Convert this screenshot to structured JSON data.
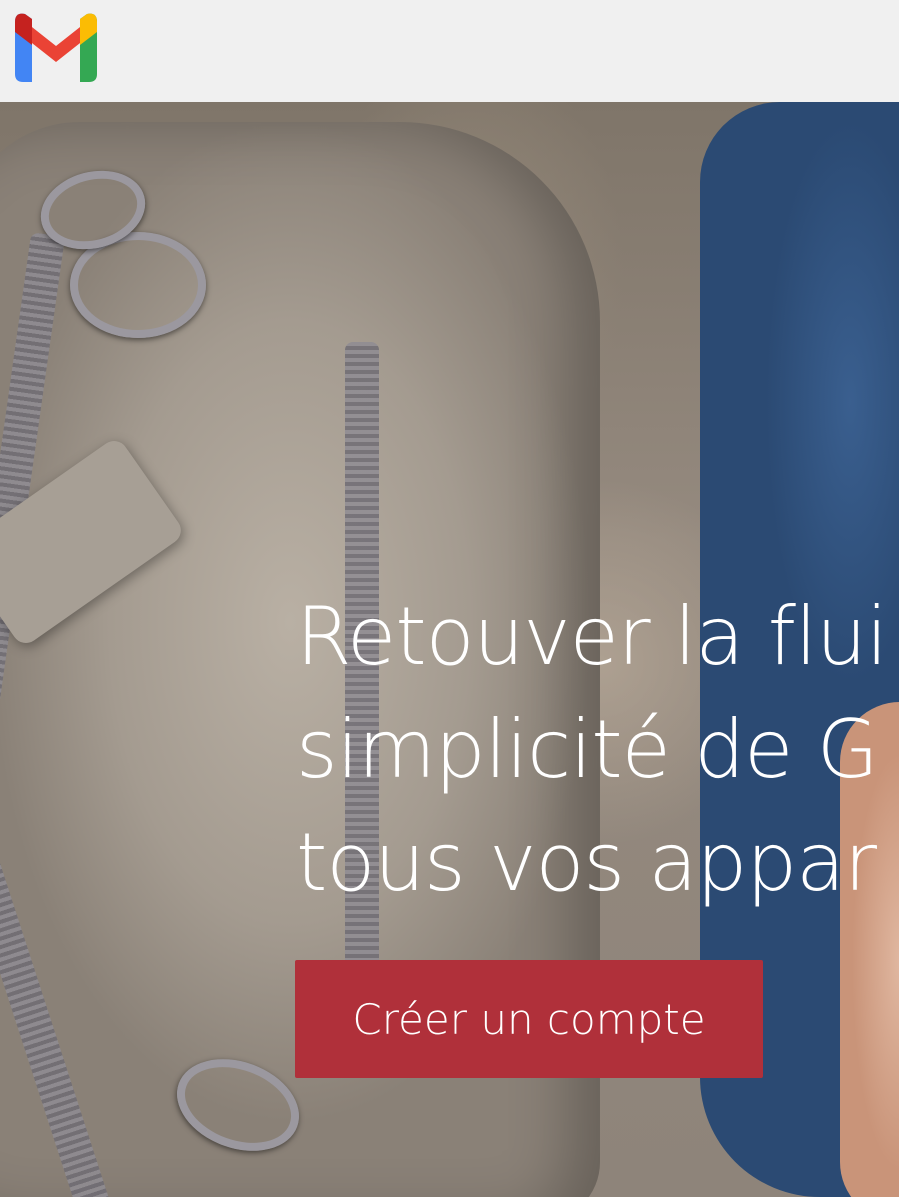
{
  "header": {
    "logo_icon": "gmail-logo-icon"
  },
  "hero": {
    "title_lines": [
      "Retouver la flui",
      "simplicité de G",
      "tous vos appar"
    ],
    "cta_label": "Créer un compte"
  },
  "colors": {
    "cta_background": "#b0303a",
    "header_background": "#f0f0f0",
    "title_text": "#ffffff"
  }
}
